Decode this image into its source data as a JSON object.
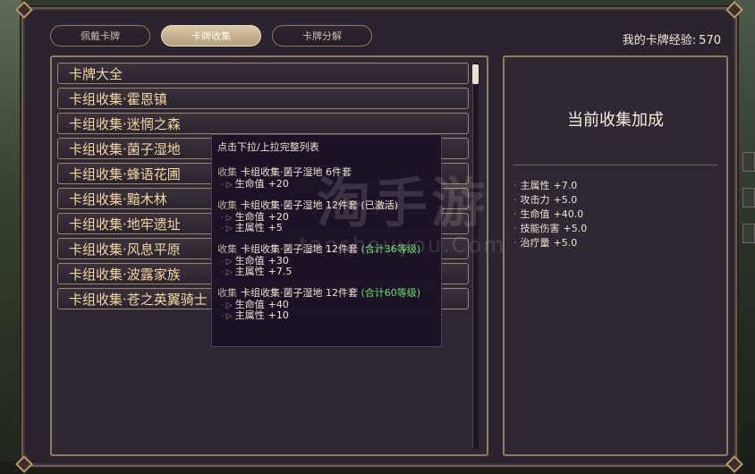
{
  "tabs": [
    {
      "label": "佩戴卡牌",
      "active": false
    },
    {
      "label": "卡牌收集",
      "active": true
    },
    {
      "label": "卡牌分解",
      "active": false
    }
  ],
  "experience": {
    "label": "我的卡牌经验:",
    "value": "570"
  },
  "collections": [
    "卡牌大全",
    "卡组收集·霍恩镇",
    "卡组收集·迷惘之森",
    "卡组收集·菌子湿地",
    "卡组收集·蜂语花圃",
    "卡组收集·黯木林",
    "卡组收集·地牢遗址",
    "卡组收集·风息平原",
    "卡组收集·波露家族",
    "卡组收集·苍之英翼骑士"
  ],
  "bonus": {
    "title": "当前收集加成",
    "stats": [
      {
        "name": "主属性",
        "value": "+7.0"
      },
      {
        "name": "攻击力",
        "value": "+5.0"
      },
      {
        "name": "生命值",
        "value": "+40.0"
      },
      {
        "name": "技能伤害",
        "value": "+5.0"
      },
      {
        "name": "治疗量",
        "value": "+5.0"
      }
    ]
  },
  "tooltip": {
    "hint": "点击下拉/上拉完整列表",
    "prefix": "收集",
    "groups": [
      {
        "name": "卡组收集·菌子湿地 6件套",
        "extra": "",
        "lines": [
          {
            "stat": "生命值",
            "value": "+20"
          }
        ]
      },
      {
        "name": "卡组收集·菌子湿地 12件套",
        "extra": "(已激活)",
        "lines": [
          {
            "stat": "生命值",
            "value": "+20"
          },
          {
            "stat": "主属性",
            "value": "+5"
          }
        ]
      },
      {
        "name": "卡组收集·菌子湿地 12件套",
        "extra": "(合计36等级)",
        "lines": [
          {
            "stat": "生命值",
            "value": "+30"
          },
          {
            "stat": "主属性",
            "value": "+7.5"
          }
        ]
      },
      {
        "name": "卡组收集·菌子湿地 12件套",
        "extra": "(合计60等级)",
        "lines": [
          {
            "stat": "生命值",
            "value": "+40"
          },
          {
            "stat": "主属性",
            "value": "+10"
          }
        ]
      }
    ]
  },
  "watermark": {
    "big": "淘手游",
    "small": "taoshouyou.Com"
  },
  "colors": {
    "accent_green": "#6ce06c",
    "row_text": "#f0d8a0",
    "frame": "#8d7d63",
    "tab_active": "#d9c9a8"
  },
  "scrollbar": {
    "position": 0.0
  }
}
